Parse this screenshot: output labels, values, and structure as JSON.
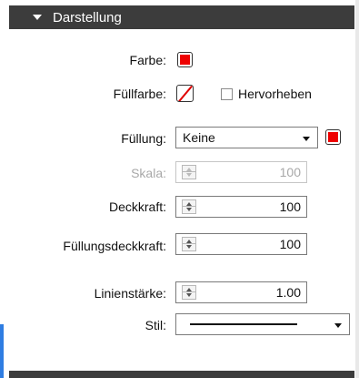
{
  "section": {
    "title": "Darstellung"
  },
  "colors": {
    "stroke_color": "#ee0000",
    "fill_color": "#ee0000",
    "header_bg": "#3c3c3c",
    "accent": "#2f7de2"
  },
  "fields": {
    "farbe_label": "Farbe:",
    "fuellfarbe_label": "Füllfarbe:",
    "hervorheben_label": "Hervorheben",
    "hervorheben_checked": false,
    "fuellung_label": "Füllung:",
    "fuellung_value": "Keine",
    "skala_label": "Skala:",
    "skala_value": "100",
    "deckkraft_label": "Deckkraft:",
    "deckkraft_value": "100",
    "fuellungsdeckkraft_label": "Füllungsdeckkraft:",
    "fuellungsdeckkraft_value": "100",
    "linienstaerke_label": "Linienstärke:",
    "linienstaerke_value": "1.00",
    "stil_label": "Stil:",
    "stil_value": "solid-line"
  }
}
